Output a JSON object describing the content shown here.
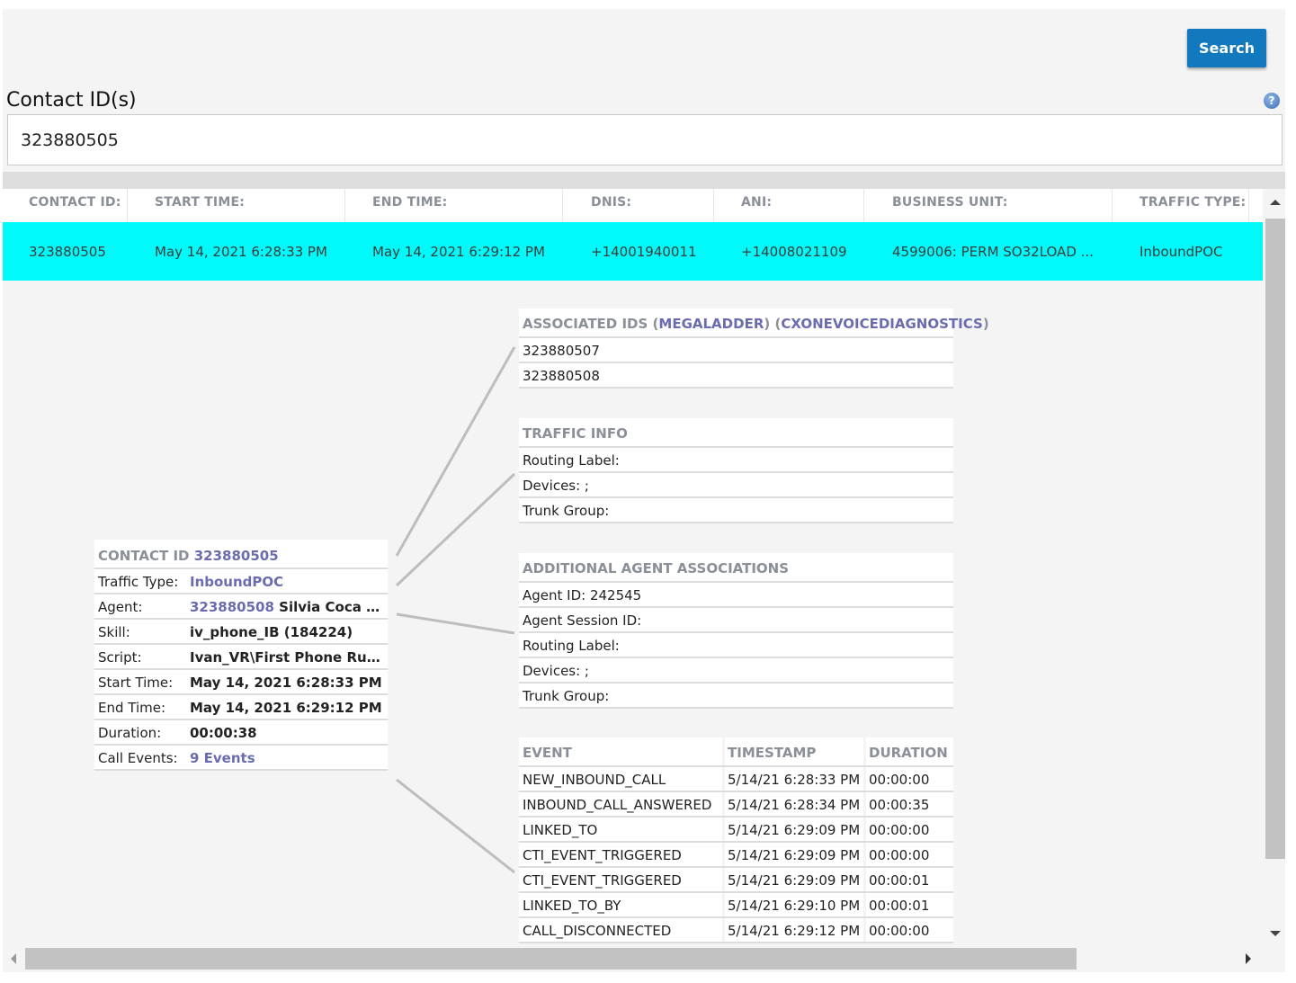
{
  "toolbar": {
    "search_label": "Search"
  },
  "contact_search": {
    "label": "Contact ID(s)",
    "help_icon": "question-circle-icon",
    "value": "323880505"
  },
  "grid": {
    "columns": [
      "CONTACT ID:",
      "START TIME:",
      "END TIME:",
      "DNIS:",
      "ANI:",
      "BUSINESS UNIT:",
      "TRAFFIC TYPE:"
    ],
    "rows": [
      [
        "323880505",
        "May 14, 2021 6:28:33 PM",
        "May 14, 2021 6:29:12 PM",
        "+14001940011",
        "+14008021109",
        "4599006: PERM SO32LOAD ...",
        "InboundPOC"
      ]
    ],
    "selected_row_color": "#00fafa"
  },
  "contact_detail": {
    "title_label": "CONTACT ID",
    "title_value": "323880505",
    "traffic_type_label": "Traffic Type:",
    "traffic_type_value": "InboundPOC",
    "agent_label": "Agent:",
    "agent_id": "323880508",
    "agent_name": " Silvia Coca (sil...",
    "skill_label": "Skill:",
    "skill_value": "iv_phone_IB (184224)",
    "script_label": "Script:",
    "script_value": "Ivan_VR\\First Phone Run...",
    "start_time_label": "Start Time:",
    "start_time_value": "May 14, 2021 6:28:33 PM",
    "end_time_label": "End Time:",
    "end_time_value": "May 14, 2021 6:29:12 PM",
    "duration_label": "Duration:",
    "duration_value": "00:00:38",
    "call_events_label": "Call Events:",
    "call_events_value": "9 Events"
  },
  "associated_ids": {
    "title_prefix": "ASSOCIATED IDS (",
    "link1": "MEGALADDER",
    "mid": ") (",
    "link2": "CXONEVOICEDIAGNOSTICS",
    "suffix": ")",
    "items": [
      "323880507",
      "323880508"
    ]
  },
  "traffic_info": {
    "title": "TRAFFIC INFO",
    "items": [
      "Routing Label:",
      "Devices: ;",
      "Trunk Group:"
    ]
  },
  "agent_associations": {
    "title": "ADDITIONAL AGENT ASSOCIATIONS",
    "items": [
      "Agent ID: 242545",
      "Agent Session ID:",
      "Routing Label:",
      "Devices: ;",
      "Trunk Group:"
    ]
  },
  "events": {
    "headers": [
      "EVENT",
      "TIMESTAMP",
      "DURATION"
    ],
    "rows": [
      [
        "NEW_INBOUND_CALL",
        "5/14/21 6:28:33 PM",
        "00:00:00"
      ],
      [
        "INBOUND_CALL_ANSWERED",
        "5/14/21 6:28:34 PM",
        "00:00:35"
      ],
      [
        "LINKED_TO",
        "5/14/21 6:29:09 PM",
        "00:00:00"
      ],
      [
        "CTI_EVENT_TRIGGERED",
        "5/14/21 6:29:09 PM",
        "00:00:00"
      ],
      [
        "CTI_EVENT_TRIGGERED",
        "5/14/21 6:29:09 PM",
        "00:00:01"
      ],
      [
        "LINKED_TO_BY",
        "5/14/21 6:29:10 PM",
        "00:00:01"
      ],
      [
        "CALL_DISCONNECTED",
        "5/14/21 6:29:12 PM",
        "00:00:00"
      ]
    ]
  },
  "colors": {
    "accent": "#1279bf",
    "link": "#6b6bb0",
    "header_text": "#8a8f98"
  }
}
